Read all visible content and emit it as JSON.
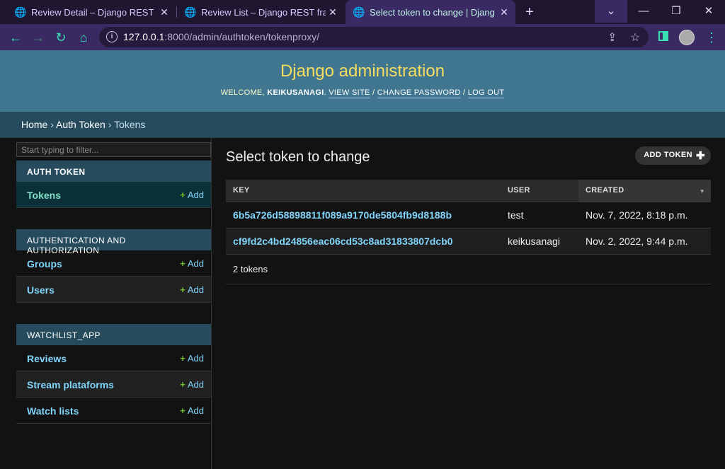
{
  "browser": {
    "tabs": [
      {
        "title": "Review Detail – Django REST framework",
        "active": false
      },
      {
        "title": "Review List – Django REST framework",
        "active": false
      },
      {
        "title": "Select token to change | Django site admin",
        "active": true
      }
    ],
    "url_host": "127.0.0.1",
    "url_path": ":8000/admin/authtoken/tokenproxy/",
    "icons": [
      "globe-icon",
      "close-icon",
      "plus-icon",
      "chevron-down-icon",
      "minimize-icon",
      "restore-icon",
      "window-close-icon",
      "back-icon",
      "forward-icon",
      "reload-icon",
      "home-icon",
      "info-icon",
      "share-icon",
      "star-icon",
      "sidebar-icon",
      "profile-avatar",
      "menu-icon"
    ],
    "colors": {
      "accent": "#39e0b4",
      "frame": "#3a2a63"
    }
  },
  "admin": {
    "branding": "Django administration",
    "user_tools": {
      "welcome": "WELCOME, ",
      "username": "KEIKUSANAGI",
      "view_site": "VIEW SITE",
      "change_password": "CHANGE PASSWORD",
      "log_out": "LOG OUT"
    },
    "breadcrumbs": {
      "home": "Home",
      "app": "Auth Token",
      "current": "Tokens"
    },
    "filter_placeholder": "Start typing to filter...",
    "modules": [
      {
        "caption": "AUTH TOKEN",
        "items": [
          {
            "label": "Tokens",
            "add": "Add"
          }
        ]
      },
      {
        "caption": "AUTHENTICATION AND AUTHORIZATION",
        "items": [
          {
            "label": "Groups",
            "add": "Add"
          },
          {
            "label": "Users",
            "add": "Add"
          }
        ]
      },
      {
        "caption": "WATCHLIST_APP",
        "items": [
          {
            "label": "Reviews",
            "add": "Add"
          },
          {
            "label": "Stream plataforms",
            "add": "Add"
          },
          {
            "label": "Watch lists",
            "add": "Add"
          }
        ]
      }
    ],
    "page_title": "Select token to change",
    "add_button": "ADD TOKEN",
    "table": {
      "headers": [
        "KEY",
        "USER",
        "CREATED"
      ],
      "rows": [
        {
          "key": "6b5a726d58898811f089a9170de5804fb9d8188b",
          "user": "test",
          "created": "Nov. 7, 2022, 8:18 p.m."
        },
        {
          "key": "cf9fd2c4bd24856eac06cd53c8ad31833807dcb0",
          "user": "keikusanagi",
          "created": "Nov. 2, 2022, 9:44 p.m."
        }
      ]
    },
    "count_text": "2 tokens",
    "colors": {
      "header": "#417690",
      "branding": "#f5dd5d",
      "breadcrumbs": "#264b5d",
      "link": "#81d4fa",
      "add_plus": "#70bf2b"
    }
  }
}
